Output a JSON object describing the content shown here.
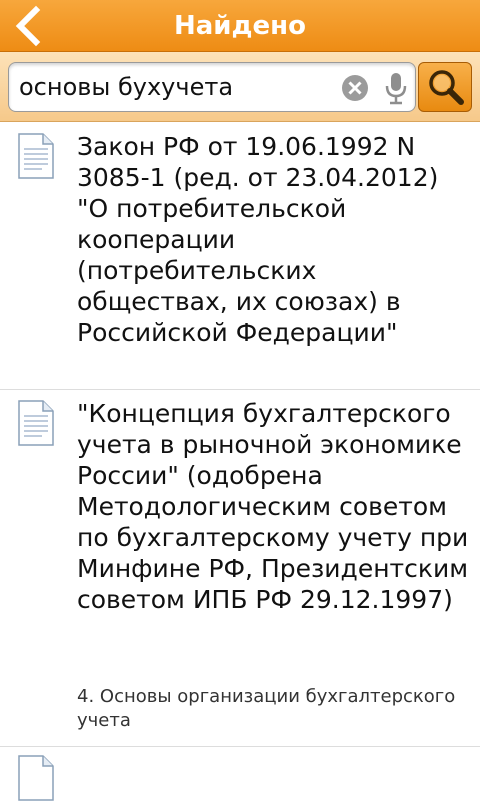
{
  "header": {
    "title": "Найдено",
    "back_icon": "chevron-left-icon",
    "background": "#f29a22"
  },
  "search": {
    "value": "основы бухучета",
    "clear_icon": "clear-icon",
    "mic_icon": "microphone-icon",
    "search_icon": "magnifier-icon"
  },
  "results": [
    {
      "icon": "document-icon",
      "title": "Закон РФ от 19.06.1992 N 3085-1 (ред. от 23.04.2012) \"О потребительской кооперации (потребительских обществах, их союзах) в Российской Федерации\"",
      "subtitle": ""
    },
    {
      "icon": "document-icon",
      "title": "\"Концепция бухгалтерского учета в рыночной экономике России\" (одобрена Методологическим советом по бухгалтерскому учету при Минфине РФ, Президентским советом ИПБ РФ 29.12.1997)",
      "subtitle": "4. Основы организации бухгалтерского учета"
    },
    {
      "icon": "document-icon",
      "title": "",
      "subtitle": ""
    }
  ]
}
